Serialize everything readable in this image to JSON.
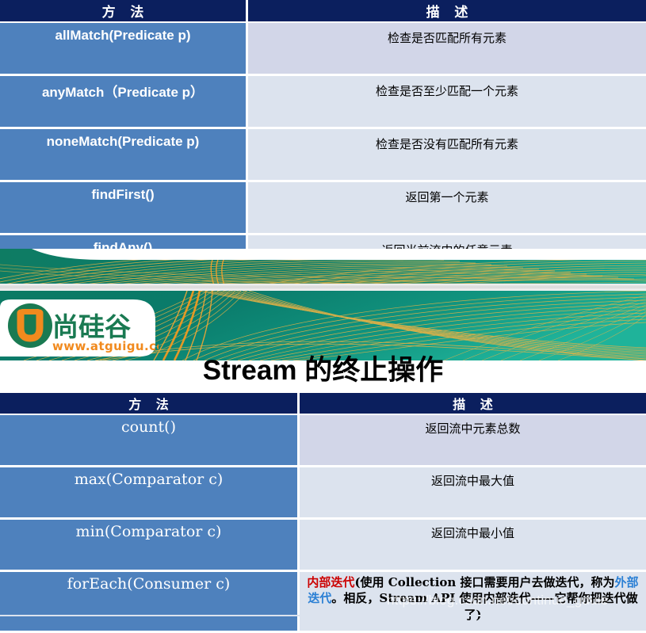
{
  "colors": {
    "header_navy": "#0b1f5e",
    "method_blue": "#4e81bd",
    "desc_light": "#dce3ee",
    "desc_first": "#d2d6e8",
    "banner_teal": "#0b7a6a",
    "banner_gold": "#e8a33d",
    "accent_red": "#cc0000",
    "accent_blue": "#2a7fd4",
    "logo_orange": "#f18a1e",
    "logo_green": "#1a7a52"
  },
  "table_one": {
    "headers": {
      "method": "方 法",
      "description": "描 述"
    },
    "rows": [
      {
        "method": "allMatch(Predicate p)",
        "description": "检查是否匹配所有元素"
      },
      {
        "method": "anyMatch（Predicate p）",
        "description": "检查是否至少匹配一个元素"
      },
      {
        "method": "noneMatch(Predicate p)",
        "description": "检查是否没有匹配所有元素"
      },
      {
        "method": "findFirst()",
        "description": "返回第一个元素"
      },
      {
        "method": "findAny()",
        "description": "返回当前流中的任意元素"
      }
    ]
  },
  "banner": {
    "logo": {
      "mark_letter": "U",
      "brand_name": "尚硅谷",
      "url": "www.atguigu.com"
    }
  },
  "slide_title": {
    "latin": "Stream",
    "cjk": " 的终止操作"
  },
  "table_two": {
    "headers": {
      "method": "方 法",
      "description": "描 述"
    },
    "rows": [
      {
        "method": "count()",
        "description": "返回流中元素总数"
      },
      {
        "method": "max(Comparator c)",
        "description": "返回流中最大值"
      },
      {
        "method": "min(Comparator c)",
        "description": "返回流中最小值"
      }
    ],
    "foreach_row": {
      "method": "forEach(Consumer c)",
      "desc_part1_red": "内部迭代",
      "desc_part2": "(使用 Collection 接口需要用户去做迭代，称为",
      "desc_part3_blue": "外部迭代",
      "desc_part4": "。相反，Stream API 使用内部迭代——它帮你把迭代做了)"
    }
  },
  "watermark": {
    "text": "https://blog.csdn.net/continue_gduie"
  }
}
